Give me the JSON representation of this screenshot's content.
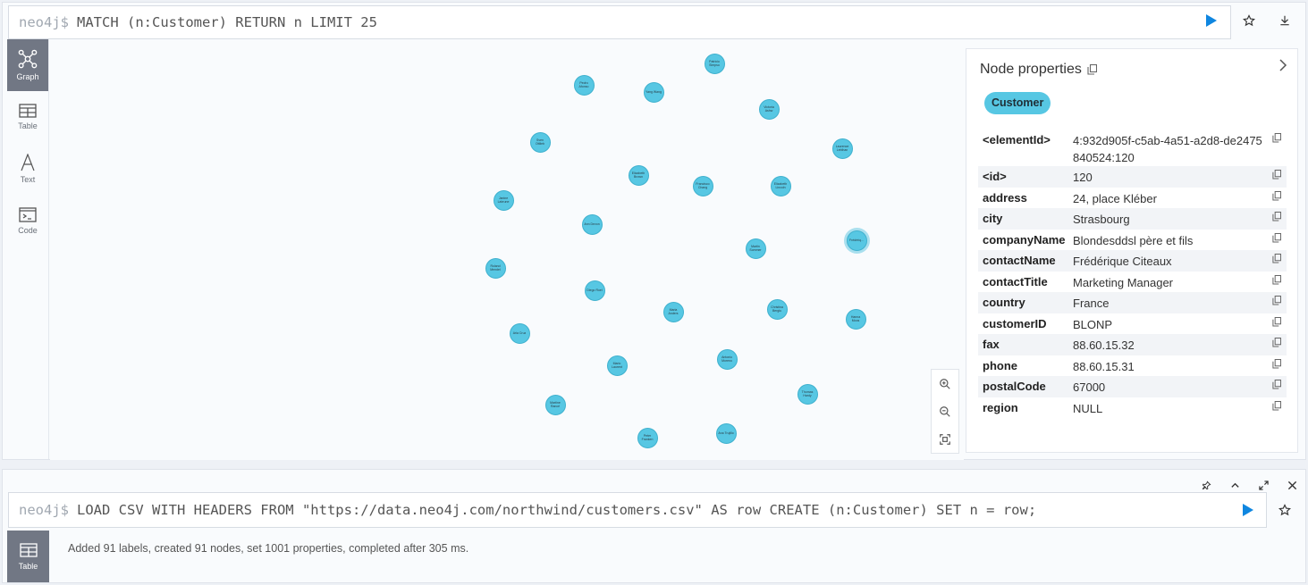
{
  "frame1": {
    "prompt": "neo4j$",
    "query": "MATCH (n:Customer) RETURN n LIMIT 25",
    "views": [
      {
        "label": "Graph",
        "icon": "graph-icon"
      },
      {
        "label": "Table",
        "icon": "table-icon"
      },
      {
        "label": "Text",
        "icon": "text-icon"
      },
      {
        "label": "Code",
        "icon": "code-icon"
      }
    ],
    "nodes": [
      {
        "caption": "Patricio Simpso"
      },
      {
        "caption": "Pedro Afonso"
      },
      {
        "caption": "Yang Wang"
      },
      {
        "caption": "Victoria Ashw"
      },
      {
        "caption": "Sven Ottlieb"
      },
      {
        "caption": "Laurence Lebihan"
      },
      {
        "caption": "Elizabeth Brown"
      },
      {
        "caption": "Francisco Chang"
      },
      {
        "caption": "Elizabeth Lincoln"
      },
      {
        "caption": "Janine Labrune"
      },
      {
        "caption": "Ann Devon"
      },
      {
        "caption": "Martin Sommer"
      },
      {
        "caption": "Frédériq..."
      },
      {
        "caption": "Roland Mendel"
      },
      {
        "caption": "Diego Roel"
      },
      {
        "caption": "Maria Anders"
      },
      {
        "caption": "Christina Berglu"
      },
      {
        "caption": "Hanna Moos"
      },
      {
        "caption": "Aria Cruz"
      },
      {
        "caption": "Mario Laurent"
      },
      {
        "caption": "Antonio Moreno"
      },
      {
        "caption": "Thomas Hardy"
      },
      {
        "caption": "Martine Rancé"
      },
      {
        "caption": "Peter Franken"
      },
      {
        "caption": "Ana Trujillo"
      }
    ],
    "properties_panel": {
      "title": "Node properties",
      "label": "Customer",
      "rows": [
        {
          "key": "<elementId>",
          "value": "4:932d905f-c5ab-4a51-a2d8-de2475840524:120"
        },
        {
          "key": "<id>",
          "value": "120"
        },
        {
          "key": "address",
          "value": "24, place Kléber"
        },
        {
          "key": "city",
          "value": "Strasbourg"
        },
        {
          "key": "companyName",
          "value": "Blondesddsl père et fils"
        },
        {
          "key": "contactName",
          "value": "Frédérique Citeaux"
        },
        {
          "key": "contactTitle",
          "value": "Marketing Manager"
        },
        {
          "key": "country",
          "value": "France"
        },
        {
          "key": "customerID",
          "value": "BLONP"
        },
        {
          "key": "fax",
          "value": "88.60.15.32"
        },
        {
          "key": "phone",
          "value": "88.60.15.31"
        },
        {
          "key": "postalCode",
          "value": "67000"
        },
        {
          "key": "region",
          "value": "NULL"
        }
      ]
    }
  },
  "frame2": {
    "prompt": "neo4j$",
    "query": "LOAD CSV WITH HEADERS FROM \"https://data.neo4j.com/northwind/customers.csv\" AS row CREATE (n:Customer) SET n = row;",
    "tab_label": "Table",
    "status": "Added 91 labels, created 91 nodes, set 1001 properties, completed after 305 ms."
  },
  "colors": {
    "node_fill": "#57c7e3",
    "run_button": "#0f86e0",
    "active_view": "#717784"
  }
}
